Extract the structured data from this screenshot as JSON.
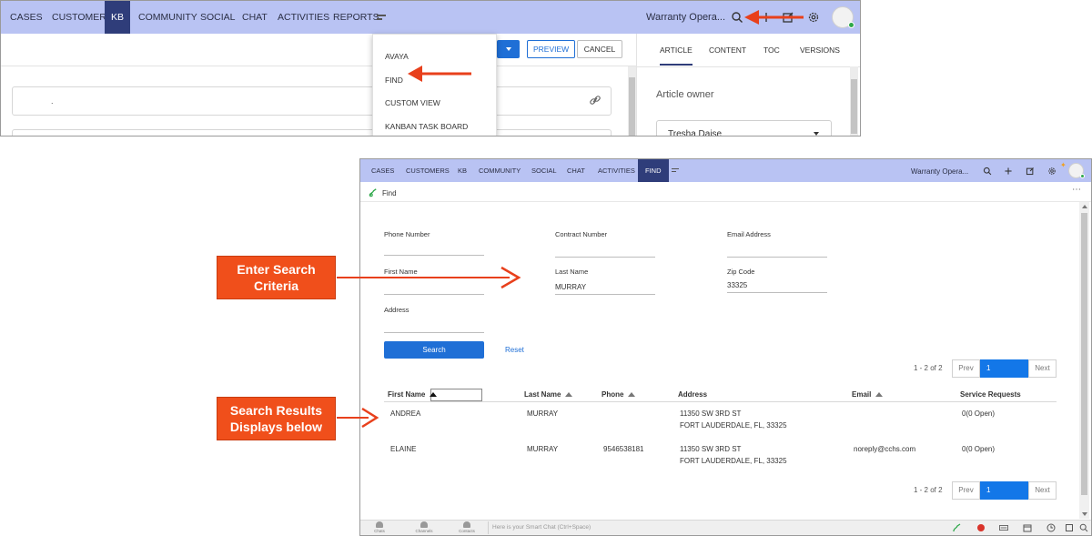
{
  "top": {
    "nav_tabs": [
      "CASES",
      "CUSTOMERS",
      "KB",
      "COMMUNITY",
      "SOCIAL",
      "CHAT",
      "ACTIVITIES",
      "REPORTS"
    ],
    "active_tab": "KB",
    "workspace": "Warranty Opera...",
    "buttons": {
      "preview": "PREVIEW",
      "cancel": "CANCEL"
    },
    "dropdown_items": [
      "AVAYA",
      "FIND",
      "CUSTOM VIEW",
      "KANBAN TASK BOARD"
    ],
    "right_tabs": [
      "ARTICLE",
      "CONTENT",
      "TOC",
      "VERSIONS"
    ],
    "field_value": ".",
    "article_owner_label": "Article owner",
    "article_owner_value": "Tresha Daise"
  },
  "bottom": {
    "nav_tabs": [
      "CASES",
      "CUSTOMERS",
      "KB",
      "COMMUNITY",
      "SOCIAL",
      "CHAT",
      "ACTIVITIES",
      "FIND"
    ],
    "active_tab": "FIND",
    "workspace": "Warranty Opera...",
    "page_title": "Find",
    "form": {
      "phone_label": "Phone Number",
      "phone_value": "",
      "contract_label": "Contract Number",
      "contract_value": "",
      "email_label": "Email Address",
      "email_value": "",
      "first_label": "First Name",
      "first_value": "",
      "last_label": "Last Name",
      "last_value": "MURRAY",
      "zip_label": "Zip Code",
      "zip_value": "33325",
      "address_label": "Address",
      "address_value": ""
    },
    "search_button": "Search",
    "reset_link": "Reset",
    "pager": {
      "count": "1 - 2 of 2",
      "prev": "Prev",
      "current": "1",
      "next": "Next"
    },
    "table": {
      "headers": [
        "First Name",
        "Last Name",
        "Phone",
        "Address",
        "Email",
        "Service Requests"
      ],
      "rows": [
        {
          "first": "ANDREA",
          "last": "MURRAY",
          "phone": "",
          "addr1": "11350 SW 3RD ST",
          "addr2": "FORT LAUDERDALE, FL, 33325",
          "email": "",
          "sr": "0(0 Open)"
        },
        {
          "first": "ELAINE",
          "last": "MURRAY",
          "phone": "9546538181",
          "addr1": "11350 SW 3RD ST",
          "addr2": "FORT LAUDERDALE, FL, 33325",
          "email": "noreply@cchs.com",
          "sr": "0(0 Open)"
        }
      ]
    },
    "bottom_bar": {
      "chats": "Chats",
      "channels": "Channels",
      "contacts": "Contacts",
      "smart_chat_placeholder": "Here is your Smart Chat (Ctrl+Space)"
    }
  },
  "callouts": {
    "enter_criteria": [
      "Enter Search",
      "Criteria"
    ],
    "results_below": [
      "Search Results",
      "Displays below"
    ]
  },
  "colors": {
    "nav_bg": "#b9c3f3",
    "active_tab": "#2f3d7a",
    "primary": "#1f6fd6",
    "callout": "#f04f1b",
    "arrow": "#e8401c"
  }
}
